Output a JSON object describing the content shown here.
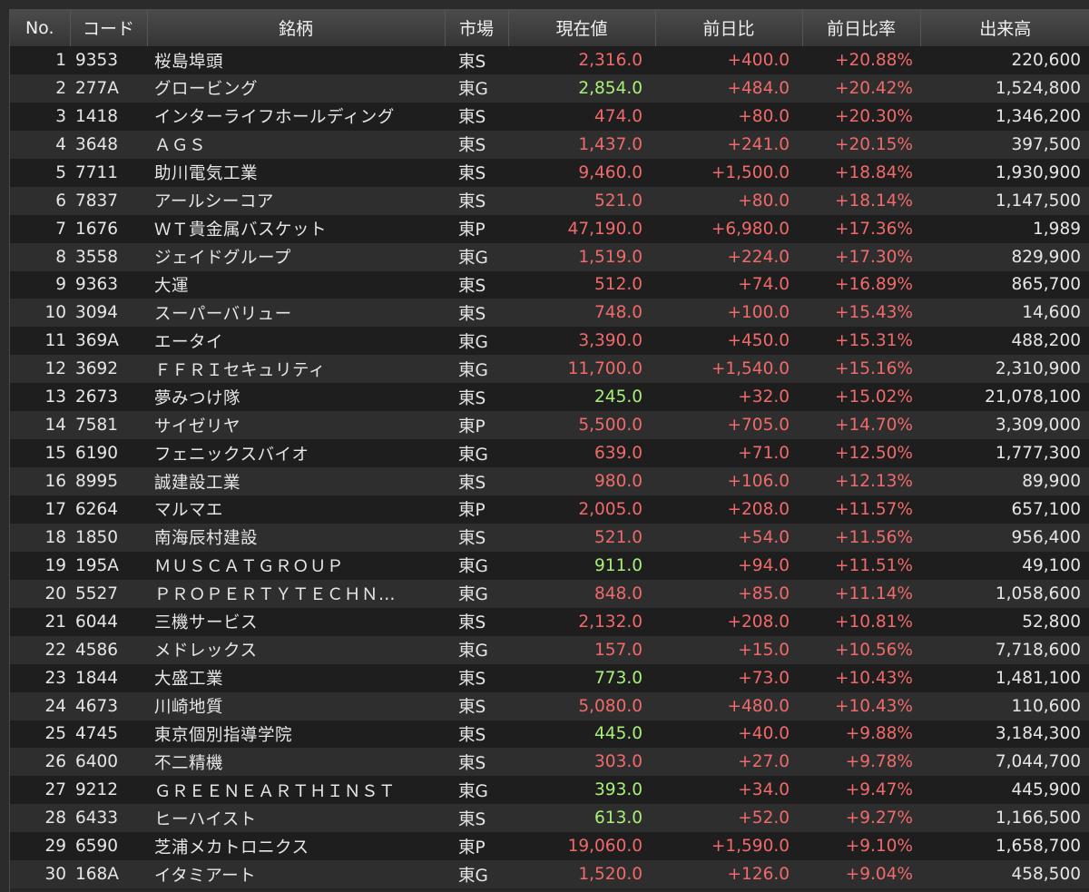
{
  "colors": {
    "up": "#f06a6a",
    "highlight": "#a8f07a",
    "text": "#e6e6e6",
    "header_bg": "#3f3f3f",
    "row_odd": "#1e1e1e",
    "row_even": "#2e2e2e"
  },
  "headers": {
    "no": "No.",
    "code": "コード",
    "name": "銘柄",
    "market": "市場",
    "price": "現在値",
    "change": "前日比",
    "change_pct": "前日比率",
    "volume": "出来高"
  },
  "rows": [
    {
      "no": "1",
      "code": "9353",
      "name": "桜島埠頭",
      "market": "東S",
      "price": "2,316.0",
      "price_color": "up",
      "change": "+400.0",
      "change_pct": "+20.88%",
      "volume": "220,600"
    },
    {
      "no": "2",
      "code": "277A",
      "name": "グロービング",
      "market": "東G",
      "price": "2,854.0",
      "price_color": "highlight",
      "change": "+484.0",
      "change_pct": "+20.42%",
      "volume": "1,524,800"
    },
    {
      "no": "3",
      "code": "1418",
      "name": "インターライフホールディング",
      "market": "東S",
      "price": "474.0",
      "price_color": "up",
      "change": "+80.0",
      "change_pct": "+20.30%",
      "volume": "1,346,200"
    },
    {
      "no": "4",
      "code": "3648",
      "name": "ＡＧＳ",
      "market": "東S",
      "price": "1,437.0",
      "price_color": "up",
      "change": "+241.0",
      "change_pct": "+20.15%",
      "volume": "397,500"
    },
    {
      "no": "5",
      "code": "7711",
      "name": "助川電気工業",
      "market": "東S",
      "price": "9,460.0",
      "price_color": "up",
      "change": "+1,500.0",
      "change_pct": "+18.84%",
      "volume": "1,930,900"
    },
    {
      "no": "6",
      "code": "7837",
      "name": "アールシーコア",
      "market": "東S",
      "price": "521.0",
      "price_color": "up",
      "change": "+80.0",
      "change_pct": "+18.14%",
      "volume": "1,147,500"
    },
    {
      "no": "7",
      "code": "1676",
      "name": "ＷＴ貴金属バスケット",
      "market": "東P",
      "price": "47,190.0",
      "price_color": "up",
      "change": "+6,980.0",
      "change_pct": "+17.36%",
      "volume": "1,989"
    },
    {
      "no": "8",
      "code": "3558",
      "name": "ジェイドグループ",
      "market": "東G",
      "price": "1,519.0",
      "price_color": "up",
      "change": "+224.0",
      "change_pct": "+17.30%",
      "volume": "829,900"
    },
    {
      "no": "9",
      "code": "9363",
      "name": "大運",
      "market": "東S",
      "price": "512.0",
      "price_color": "up",
      "change": "+74.0",
      "change_pct": "+16.89%",
      "volume": "865,700"
    },
    {
      "no": "10",
      "code": "3094",
      "name": "スーパーバリュー",
      "market": "東S",
      "price": "748.0",
      "price_color": "up",
      "change": "+100.0",
      "change_pct": "+15.43%",
      "volume": "14,600"
    },
    {
      "no": "11",
      "code": "369A",
      "name": "エータイ",
      "market": "東G",
      "price": "3,390.0",
      "price_color": "up",
      "change": "+450.0",
      "change_pct": "+15.31%",
      "volume": "488,200"
    },
    {
      "no": "12",
      "code": "3692",
      "name": "ＦＦＲＩセキュリティ",
      "market": "東G",
      "price": "11,700.0",
      "price_color": "up",
      "change": "+1,540.0",
      "change_pct": "+15.16%",
      "volume": "2,310,900"
    },
    {
      "no": "13",
      "code": "2673",
      "name": "夢みつけ隊",
      "market": "東S",
      "price": "245.0",
      "price_color": "highlight",
      "change": "+32.0",
      "change_pct": "+15.02%",
      "volume": "21,078,100"
    },
    {
      "no": "14",
      "code": "7581",
      "name": "サイゼリヤ",
      "market": "東P",
      "price": "5,500.0",
      "price_color": "up",
      "change": "+705.0",
      "change_pct": "+14.70%",
      "volume": "3,309,000"
    },
    {
      "no": "15",
      "code": "6190",
      "name": "フェニックスバイオ",
      "market": "東G",
      "price": "639.0",
      "price_color": "up",
      "change": "+71.0",
      "change_pct": "+12.50%",
      "volume": "1,777,300"
    },
    {
      "no": "16",
      "code": "8995",
      "name": "誠建設工業",
      "market": "東S",
      "price": "980.0",
      "price_color": "up",
      "change": "+106.0",
      "change_pct": "+12.13%",
      "volume": "89,900"
    },
    {
      "no": "17",
      "code": "6264",
      "name": "マルマエ",
      "market": "東P",
      "price": "2,005.0",
      "price_color": "up",
      "change": "+208.0",
      "change_pct": "+11.57%",
      "volume": "657,100"
    },
    {
      "no": "18",
      "code": "1850",
      "name": "南海辰村建設",
      "market": "東S",
      "price": "521.0",
      "price_color": "up",
      "change": "+54.0",
      "change_pct": "+11.56%",
      "volume": "956,400"
    },
    {
      "no": "19",
      "code": "195A",
      "name": "ＭＵＳＣＡＴＧＲＯＵＰ",
      "market": "東G",
      "price": "911.0",
      "price_color": "highlight",
      "change": "+94.0",
      "change_pct": "+11.51%",
      "volume": "49,100"
    },
    {
      "no": "20",
      "code": "5527",
      "name": "ＰＲＯＰＥＲＴＹＴＥＣＨＮ…",
      "market": "東G",
      "price": "848.0",
      "price_color": "up",
      "change": "+85.0",
      "change_pct": "+11.14%",
      "volume": "1,058,600"
    },
    {
      "no": "21",
      "code": "6044",
      "name": "三機サービス",
      "market": "東S",
      "price": "2,132.0",
      "price_color": "up",
      "change": "+208.0",
      "change_pct": "+10.81%",
      "volume": "52,800"
    },
    {
      "no": "22",
      "code": "4586",
      "name": "メドレックス",
      "market": "東G",
      "price": "157.0",
      "price_color": "up",
      "change": "+15.0",
      "change_pct": "+10.56%",
      "volume": "7,718,600"
    },
    {
      "no": "23",
      "code": "1844",
      "name": "大盛工業",
      "market": "東S",
      "price": "773.0",
      "price_color": "highlight",
      "change": "+73.0",
      "change_pct": "+10.43%",
      "volume": "1,481,100"
    },
    {
      "no": "24",
      "code": "4673",
      "name": "川崎地質",
      "market": "東S",
      "price": "5,080.0",
      "price_color": "up",
      "change": "+480.0",
      "change_pct": "+10.43%",
      "volume": "110,600"
    },
    {
      "no": "25",
      "code": "4745",
      "name": "東京個別指導学院",
      "market": "東S",
      "price": "445.0",
      "price_color": "highlight",
      "change": "+40.0",
      "change_pct": "+9.88%",
      "volume": "3,184,300"
    },
    {
      "no": "26",
      "code": "6400",
      "name": "不二精機",
      "market": "東S",
      "price": "303.0",
      "price_color": "up",
      "change": "+27.0",
      "change_pct": "+9.78%",
      "volume": "7,044,700"
    },
    {
      "no": "27",
      "code": "9212",
      "name": "ＧＲＥＥＮＥＡＲＴＨＩＮＳＴ",
      "market": "東G",
      "price": "393.0",
      "price_color": "highlight",
      "change": "+34.0",
      "change_pct": "+9.47%",
      "volume": "445,900"
    },
    {
      "no": "28",
      "code": "6433",
      "name": "ヒーハイスト",
      "market": "東S",
      "price": "613.0",
      "price_color": "highlight",
      "change": "+52.0",
      "change_pct": "+9.27%",
      "volume": "1,166,500"
    },
    {
      "no": "29",
      "code": "6590",
      "name": "芝浦メカトロニクス",
      "market": "東P",
      "price": "19,060.0",
      "price_color": "up",
      "change": "+1,590.0",
      "change_pct": "+9.10%",
      "volume": "1,658,700"
    },
    {
      "no": "30",
      "code": "168A",
      "name": "イタミアート",
      "market": "東G",
      "price": "1,520.0",
      "price_color": "up",
      "change": "+126.0",
      "change_pct": "+9.04%",
      "volume": "458,500"
    }
  ]
}
